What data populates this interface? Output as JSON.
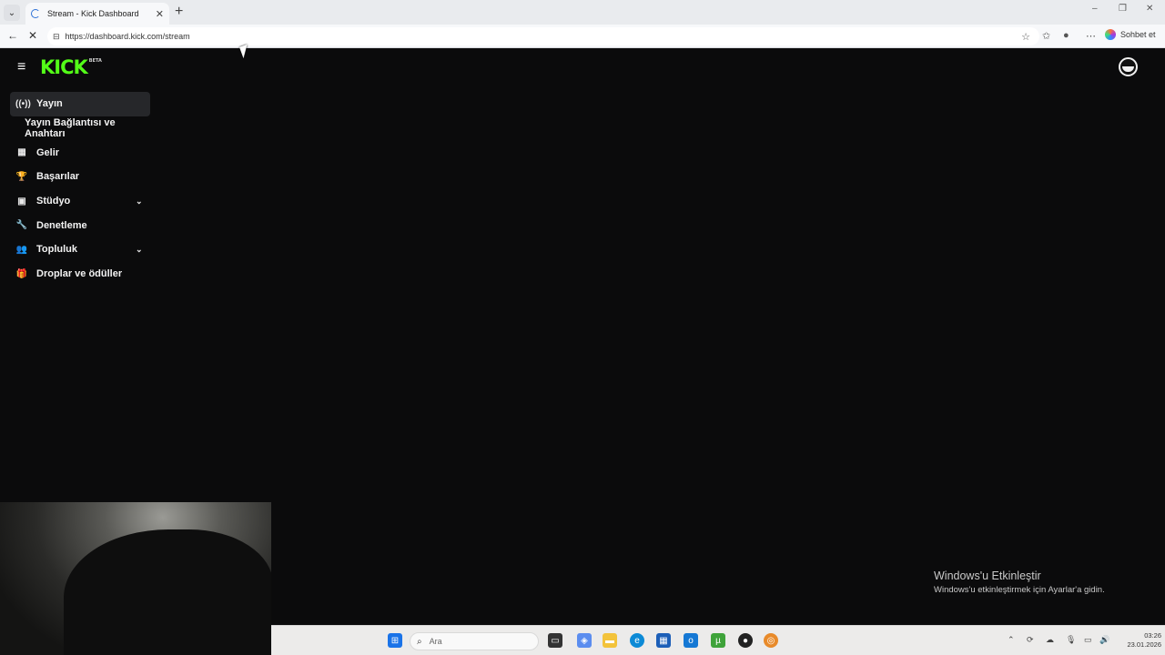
{
  "browser": {
    "tab_title": "Stream - Kick Dashboard",
    "tab_close": "✕",
    "new_tab": "+",
    "url": "https://dashboard.kick.com/stream",
    "copilot_label": "Sohbet et",
    "window_controls": {
      "minimize": "–",
      "restore": "❐",
      "close": "✕"
    }
  },
  "app": {
    "logo_text": "KICK",
    "logo_badge": "BETA",
    "brand_color": "#53fc18"
  },
  "sidebar": {
    "items": [
      {
        "label": "Yayın",
        "icon": "broadcast-icon",
        "glyph": "((•))",
        "active": true
      },
      {
        "label": "Yayın Bağlantısı ve Anahtarı",
        "sub": true
      },
      {
        "label": "Gelir",
        "icon": "chart-icon",
        "glyph": "▦"
      },
      {
        "label": "Başarılar",
        "icon": "trophy-icon",
        "glyph": "🏆"
      },
      {
        "label": "Stüdyo",
        "icon": "studio-icon",
        "glyph": "▣",
        "expandable": true
      },
      {
        "label": "Denetleme",
        "icon": "wrench-icon",
        "glyph": "🔧"
      },
      {
        "label": "Topluluk",
        "icon": "community-icon",
        "glyph": "👥",
        "expandable": true
      },
      {
        "label": "Droplar ve ödüller",
        "icon": "gift-icon",
        "glyph": "🎁"
      }
    ],
    "chevron": "⌄"
  },
  "windows_activation": {
    "title": "Windows'u Etkinleştir",
    "subtitle": "Windows'u etkinleştirmek için Ayarlar'a gidin."
  },
  "taskbar": {
    "search_placeholder": "Ara",
    "time": "03:26",
    "date": "23.01.2026"
  }
}
